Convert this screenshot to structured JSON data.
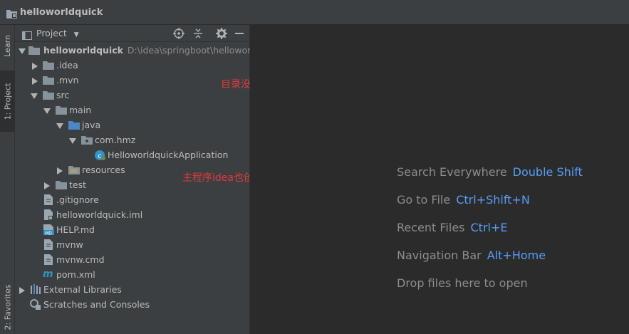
{
  "window": {
    "title": "helloworldquick"
  },
  "left_strip": {
    "learn_label": "Learn",
    "project_label": "1: Project",
    "favorites_label": "2: Favorites"
  },
  "panel": {
    "title": "Project"
  },
  "tree": {
    "root_name": "helloworldquick",
    "root_path": "D:\\idea\\springboot\\helloworldq",
    "items": [
      {
        "label": ".idea"
      },
      {
        "label": ".mvn"
      },
      {
        "label": "src"
      },
      {
        "label": "main"
      },
      {
        "label": "java"
      },
      {
        "label": "com.hmz"
      },
      {
        "label": "HelloworldquickApplication"
      },
      {
        "label": "resources"
      },
      {
        "label": "test"
      },
      {
        "label": ".gitignore"
      },
      {
        "label": "helloworldquick.iml"
      },
      {
        "label": "HELP.md"
      },
      {
        "label": "mvnw"
      },
      {
        "label": "mvnw.cmd"
      },
      {
        "label": "pom.xml"
      },
      {
        "label": "External Libraries"
      },
      {
        "label": "Scratches and Consoles"
      }
    ]
  },
  "annotations": {
    "a1": "目录没问题",
    "a2": "主程序idea也创建好了"
  },
  "editor": {
    "hints": [
      {
        "label": "Search Everywhere",
        "key": "Double Shift"
      },
      {
        "label": "Go to File",
        "key": "Ctrl+Shift+N"
      },
      {
        "label": "Recent Files",
        "key": "Ctrl+E"
      },
      {
        "label": "Navigation Bar",
        "key": "Alt+Home"
      }
    ],
    "drop_text": "Drop files here to open"
  },
  "colors": {
    "background": "#2b2b2b",
    "panel": "#3c3f41",
    "accent_key": "#589df6",
    "annotation": "#e03a3a"
  }
}
